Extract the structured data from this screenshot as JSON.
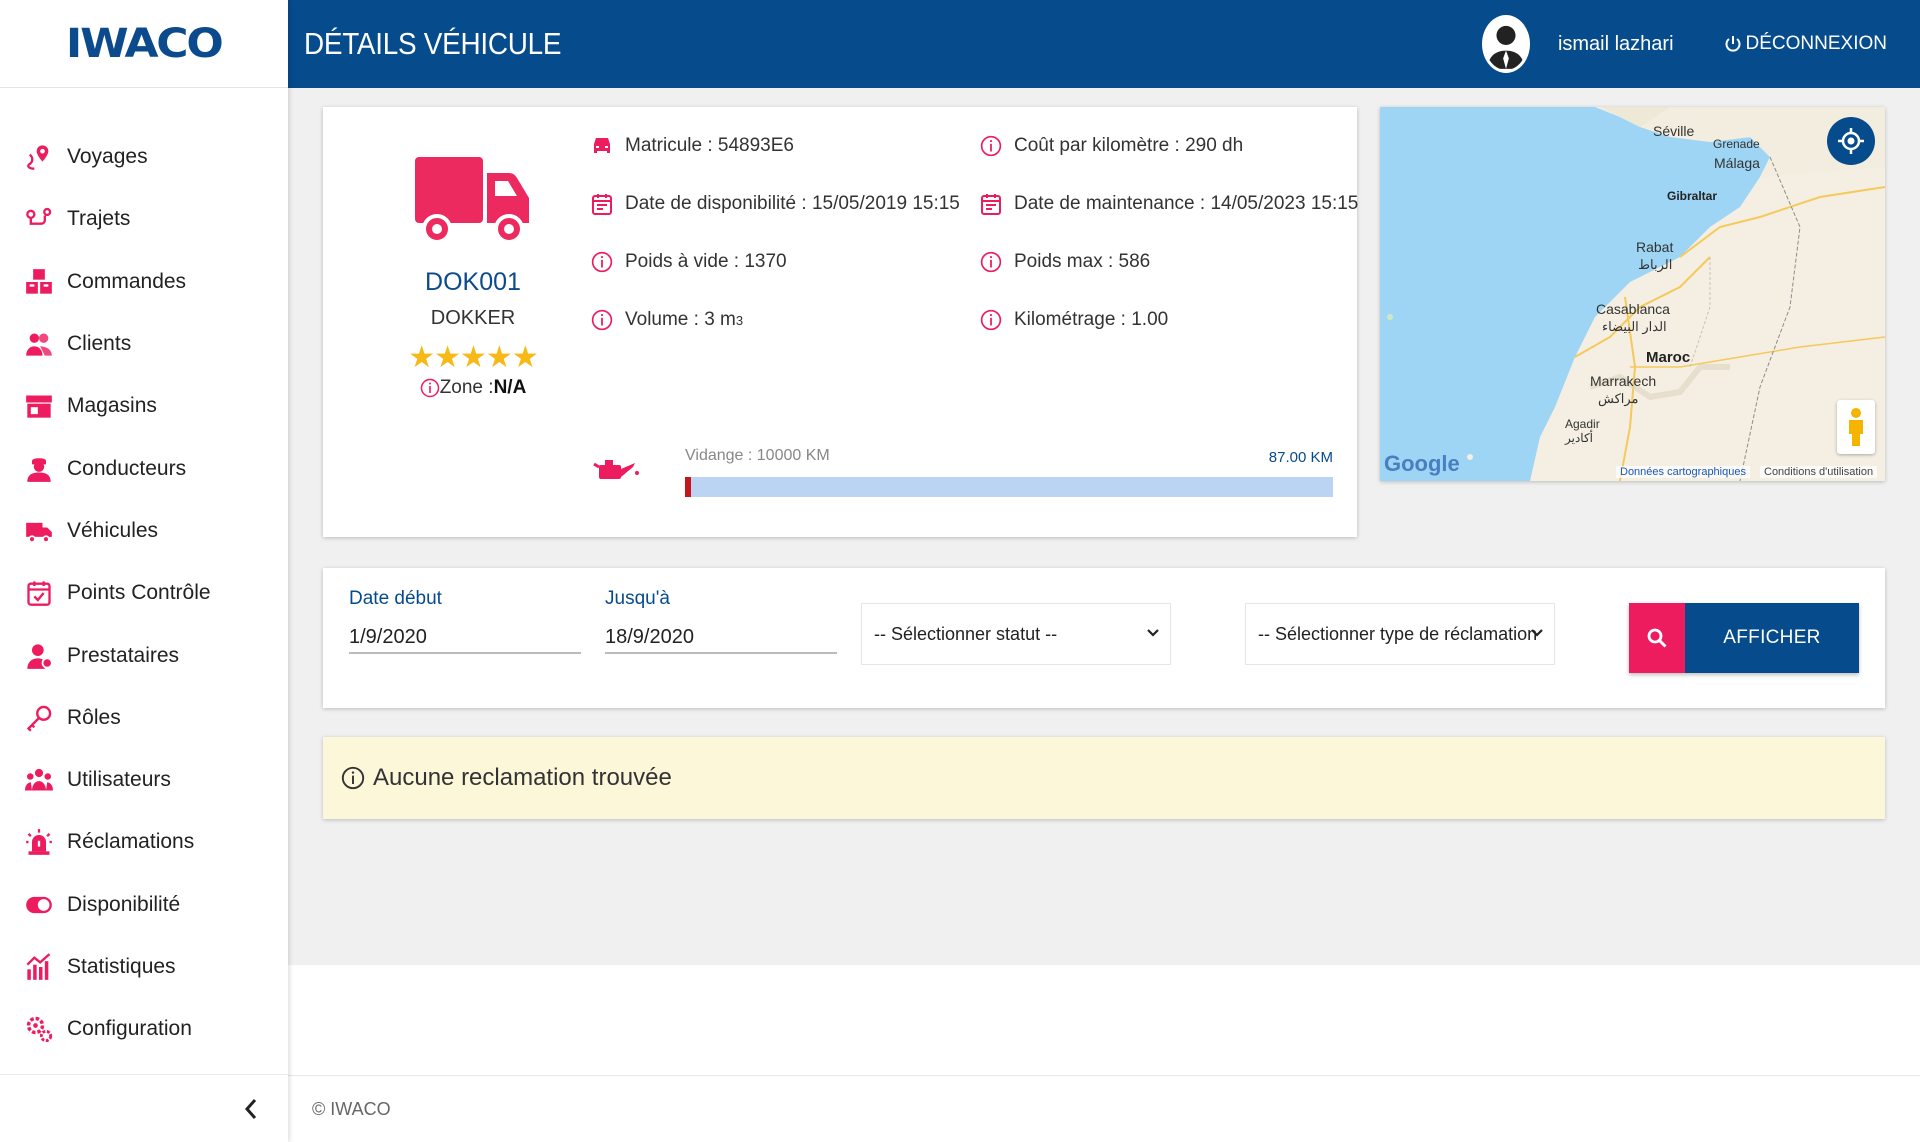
{
  "app": {
    "logo": "IWACO",
    "page_title": "DÉTAILS VÉHICULE"
  },
  "header": {
    "user_name": "ismail lazhari",
    "logout_label": "DÉCONNEXION"
  },
  "sidebar": {
    "items": [
      {
        "label": "Voyages",
        "icon": "route-pin-icon"
      },
      {
        "label": "Trajets",
        "icon": "trajet-icon"
      },
      {
        "label": "Commandes",
        "icon": "boxes-icon"
      },
      {
        "label": "Clients",
        "icon": "users-icon"
      },
      {
        "label": "Magasins",
        "icon": "store-icon"
      },
      {
        "label": "Conducteurs",
        "icon": "driver-icon"
      },
      {
        "label": "Véhicules",
        "icon": "truck-icon"
      },
      {
        "label": "Points Contrôle",
        "icon": "calendar-check-icon"
      },
      {
        "label": "Prestataires",
        "icon": "person-icon"
      },
      {
        "label": "Rôles",
        "icon": "key-icon"
      },
      {
        "label": "Utilisateurs",
        "icon": "group-icon"
      },
      {
        "label": "Réclamations",
        "icon": "alarm-icon"
      },
      {
        "label": "Disponibilité",
        "icon": "toggle-icon"
      },
      {
        "label": "Statistiques",
        "icon": "chart-icon"
      },
      {
        "label": "Configuration",
        "icon": "gears-icon"
      }
    ],
    "accent": "#ec1c5f"
  },
  "vehicle": {
    "code": "DOK001",
    "model": "DOKKER",
    "stars": "★★★★★",
    "zone_label": "Zone :",
    "zone_value": "N/A",
    "matricule": "Matricule : 54893E6",
    "cout_km": "Coût par kilomètre : 290 dh",
    "date_dispo": "Date de disponibilité : 15/05/2019 15:15",
    "date_maint": "Date de maintenance : 14/05/2023 15:15",
    "poids_vide": "Poids à vide : 1370",
    "poids_max": "Poids max : 586",
    "volume": "Volume : 3 m",
    "volume_sup": "3",
    "kilometrage": "Kilométrage : 1.00",
    "vidange_label": "Vidange : 10000 KM",
    "vidange_km": "87.00 KM",
    "vidange_progress": 0.0087
  },
  "map": {
    "labels": {
      "seville": "Séville",
      "grenade": "Grenade",
      "malaga": "Málaga",
      "gibraltar": "Gibraltar",
      "rabat": "Rabat",
      "rabat_ar": "الرباط",
      "casablanca": "Casablanca",
      "casablanca_ar": "الدار البيضاء",
      "maroc": "Maroc",
      "marrakech": "Marrakech",
      "marrakech_ar": "مراكش",
      "agadir": "Agadir",
      "agadir_ar": "أكادير",
      "google": "Google",
      "donnees": "Données cartographiques",
      "conditions": "Conditions d'utilisation"
    }
  },
  "filters": {
    "date_debut_label": "Date début",
    "date_debut_value": "1/9/2020",
    "jusqua_label": "Jusqu'à",
    "jusqua_value": "18/9/2020",
    "statut_placeholder": "-- Sélectionner statut --",
    "type_placeholder": "-- Sélectionner type de réclamation",
    "afficher_label": "AFFICHER"
  },
  "alert": {
    "message": "Aucune reclamation trouvée"
  },
  "footer": {
    "copyright": "© IWACO"
  }
}
